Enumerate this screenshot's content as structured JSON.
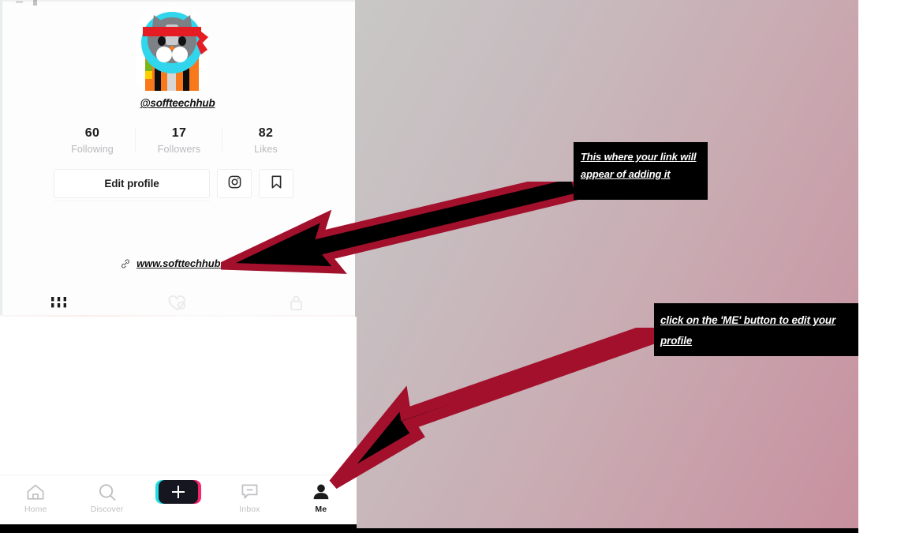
{
  "background": {
    "gradient_from": "#c7cec9",
    "gradient_to": "#c8909f",
    "accent_red": "#a3102c",
    "arrow_fill": "#000000"
  },
  "profile": {
    "avatar_icon": "cat-avatar-with-red-headband",
    "username": "@soffteechhub",
    "stats": [
      {
        "count": "60",
        "label": "Following"
      },
      {
        "count": "17",
        "label": "Followers"
      },
      {
        "count": "82",
        "label": "Likes"
      }
    ],
    "actions": {
      "edit_profile_label": "Edit profile",
      "instagram_icon": "instagram-camera-icon",
      "bookmark_icon": "bookmark-icon"
    },
    "bio_link": {
      "icon": "link-chain-icon",
      "text": "www.softtechhub.us"
    },
    "tabs": [
      {
        "icon": "grid-posts-icon",
        "active": true
      },
      {
        "icon": "heart-slash-liked-icon",
        "active": false
      },
      {
        "icon": "lock-private-icon",
        "active": false
      }
    ]
  },
  "bottom_nav": {
    "items": [
      {
        "label": "Home",
        "icon": "home-icon",
        "active": false
      },
      {
        "label": "Discover",
        "icon": "search-icon",
        "active": false
      },
      {
        "label": "",
        "icon": "create-plus-icon",
        "active": false
      },
      {
        "label": "Inbox",
        "icon": "message-icon",
        "active": false
      },
      {
        "label": "Me",
        "icon": "person-icon",
        "active": true
      }
    ]
  },
  "annotations": {
    "callout_1": "This where your link will appear of adding it",
    "callout_2": "click on the 'ME' button to edit your profile",
    "arrow_1_name": "arrow-pointing-to-bio-link",
    "arrow_2_name": "arrow-pointing-to-me-tab"
  }
}
